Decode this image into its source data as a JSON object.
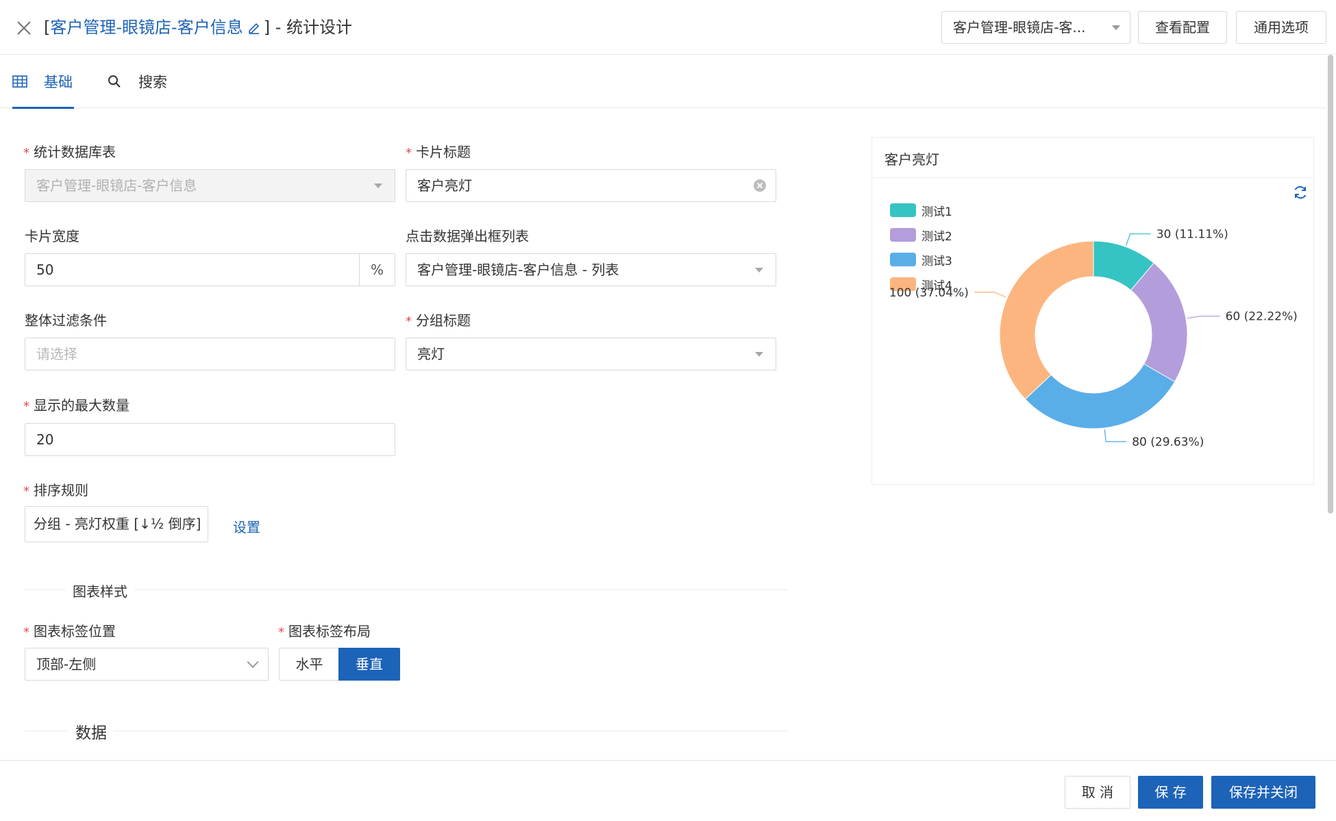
{
  "header": {
    "title_prefix": "[",
    "title_link": "客户管理-眼镜店-客户信息",
    "title_suffix": "] - 统计设计",
    "select_value": "客户管理-眼镜店-客...",
    "view_config_label": "查看配置",
    "general_options_label": "通用选项"
  },
  "tabs": [
    {
      "label": "基础",
      "icon": "table-icon",
      "active": true
    },
    {
      "label": "搜索",
      "icon": "search-icon",
      "active": false
    }
  ],
  "form": {
    "db_table": {
      "label": "统计数据库表",
      "value": "客户管理-眼镜店-客户信息",
      "required": true
    },
    "card_title": {
      "label": "卡片标题",
      "value": "客户亮灯",
      "required": true
    },
    "card_width": {
      "label": "卡片宽度",
      "value": "50",
      "suffix": "%"
    },
    "popup_list": {
      "label": "点击数据弹出框列表",
      "value": "客户管理-眼镜店-客户信息 - 列表"
    },
    "filter": {
      "label": "整体过滤条件",
      "placeholder": "请选择"
    },
    "group_title": {
      "label": "分组标题",
      "value": "亮灯",
      "required": true
    },
    "max_count": {
      "label": "显示的最大数量",
      "value": "20",
      "required": true
    },
    "sort_rule": {
      "label": "排序规则",
      "value": "分组 - 亮灯权重 [↓½ 倒序]",
      "required": true,
      "settings_link": "设置"
    },
    "chart_style_section": "图表样式",
    "label_position": {
      "label": "图表标签位置",
      "value": "顶部-左侧",
      "required": true
    },
    "label_layout": {
      "label": "图表标签布局",
      "required": true,
      "options": [
        "水平",
        "垂直"
      ],
      "selected": "垂直"
    },
    "data_section": "数据"
  },
  "preview": {
    "title": "客户亮灯",
    "refresh_icon": "refresh-icon"
  },
  "chart_data": {
    "type": "pie",
    "variant": "donut",
    "series": [
      {
        "name": "测试1",
        "value": 30,
        "label": "30 (11.11%)",
        "color": "#36c3c4"
      },
      {
        "name": "测试2",
        "value": 60,
        "label": "60 (22.22%)",
        "color": "#b39ddb"
      },
      {
        "name": "测试3",
        "value": 80,
        "label": "80 (29.63%)",
        "color": "#5aaee8"
      },
      {
        "name": "测试4",
        "value": 100,
        "label": "100 (37.04%)",
        "color": "#fdb57f"
      }
    ],
    "legend": "top-left"
  },
  "footer": {
    "cancel_label": "取 消",
    "save_label": "保 存",
    "save_close_label": "保存并关闭"
  },
  "colors": {
    "primary": "#1d63b8",
    "required": "#e5484d"
  }
}
